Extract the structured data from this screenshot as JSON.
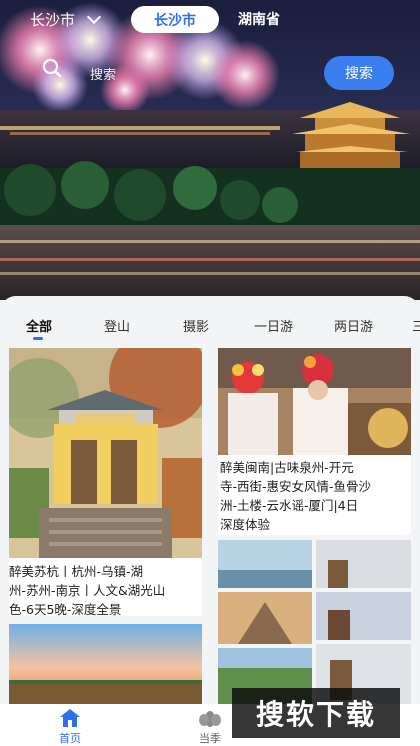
{
  "header": {
    "city_label": "长沙市",
    "city_chip_active": "长沙市",
    "province_chip": "湖南省"
  },
  "search": {
    "placeholder": "搜索",
    "button_label": "搜索"
  },
  "tabs": [
    "全部",
    "登山",
    "摄影",
    "一日游",
    "两日游",
    "三"
  ],
  "cards": [
    {
      "caption": "醉美苏杭丨杭州-乌镇-湖州-苏州-南京丨人文&湖光山色-6天5晚-深度全景",
      "lines": [
        "醉美苏杭丨杭州-乌镇-湖",
        "州-苏州-南京丨人文&湖光山",
        "色-6天5晚-深度全景"
      ]
    },
    {
      "caption": "醉美闽南|古味泉州-开元寺-西街-惠安女风情-鱼骨沙洲-土楼-云水谣-厦门|4日深度体验",
      "lines": [
        "醉美闽南|古味泉州-开元",
        "寺-西街-惠安女风情-鱼骨沙",
        "洲-土楼-云水谣-厦门|4日",
        "深度体验"
      ]
    }
  ],
  "bottom_nav": [
    {
      "label": "首页",
      "icon": "home-icon",
      "active": true
    },
    {
      "label": "当季",
      "icon": "flower-icon",
      "active": false
    }
  ],
  "watermark": "搜软下载",
  "colors": {
    "accent": "#2f6fe8",
    "search_button": "#3b7ef0"
  }
}
